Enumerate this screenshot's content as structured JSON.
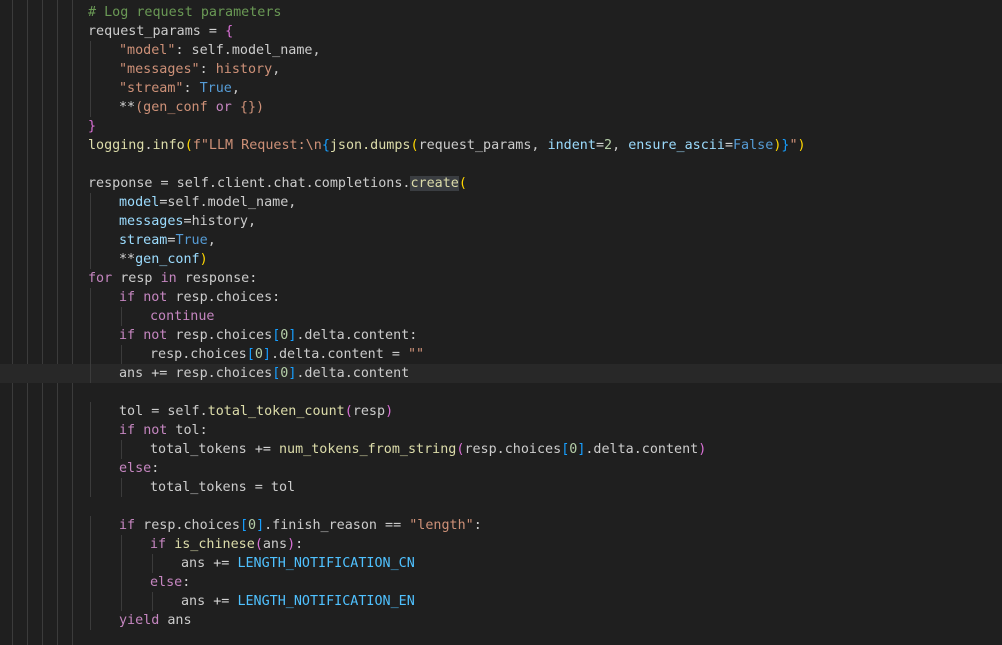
{
  "theme": {
    "background": "#1f1f1f",
    "current_line": "#282828",
    "guides": "#3b3b3b"
  },
  "code": {
    "current_line_index": 19,
    "lines": [
      {
        "indent": 0,
        "segments": [
          [
            "# Log request parameters",
            "comment"
          ]
        ]
      },
      {
        "indent": 0,
        "segments": [
          [
            "request_params",
            "default"
          ],
          [
            " = ",
            "operator"
          ],
          [
            "{",
            "bracket2"
          ]
        ]
      },
      {
        "indent": 1,
        "segments": [
          [
            "\"model\"",
            "string"
          ],
          [
            ": self.model_name,",
            "default"
          ]
        ]
      },
      {
        "indent": 1,
        "segments": [
          [
            "\"messages\"",
            "string"
          ],
          [
            ": ",
            "default"
          ],
          [
            "history",
            "string"
          ],
          [
            ",",
            "default"
          ]
        ]
      },
      {
        "indent": 1,
        "segments": [
          [
            "\"stream\"",
            "string"
          ],
          [
            ": ",
            "default"
          ],
          [
            "True",
            "keyword2"
          ],
          [
            ",",
            "default"
          ]
        ]
      },
      {
        "indent": 1,
        "segments": [
          [
            "**",
            "operator"
          ],
          [
            "(gen_conf ",
            "string"
          ],
          [
            "or",
            "keyword"
          ],
          [
            " {})",
            "string"
          ]
        ]
      },
      {
        "indent": 0,
        "segments": [
          [
            "}",
            "bracket2"
          ]
        ]
      },
      {
        "indent": 0,
        "segments": [
          [
            "logging",
            "func"
          ],
          [
            ".",
            "default"
          ],
          [
            "info",
            "func"
          ],
          [
            "(",
            "bracket1"
          ],
          [
            "f\"LLM Request:\\n",
            "string"
          ],
          [
            "{",
            "bracket3"
          ],
          [
            "json.dumps",
            "func"
          ],
          [
            "(",
            "bracket1"
          ],
          [
            "request_params, ",
            "default"
          ],
          [
            "indent",
            "param"
          ],
          [
            "=",
            "operator"
          ],
          [
            "2",
            "number"
          ],
          [
            ", ",
            "default"
          ],
          [
            "ensure_ascii",
            "param"
          ],
          [
            "=",
            "operator"
          ],
          [
            "False",
            "keyword2"
          ],
          [
            ")",
            "bracket1"
          ],
          [
            "}",
            "bracket3"
          ],
          [
            "\"",
            "string"
          ],
          [
            ")",
            "bracket1"
          ]
        ]
      },
      {
        "indent": 0,
        "segments": []
      },
      {
        "indent": 0,
        "segments": [
          [
            "response = self.client.chat.completions.",
            "default"
          ],
          [
            "create",
            "func",
            "hl"
          ],
          [
            "(",
            "bracket1"
          ]
        ]
      },
      {
        "indent": 1,
        "segments": [
          [
            "model",
            "param"
          ],
          [
            "=",
            "operator"
          ],
          [
            "self.model_name,",
            "default"
          ]
        ]
      },
      {
        "indent": 1,
        "segments": [
          [
            "messages",
            "param"
          ],
          [
            "=",
            "operator"
          ],
          [
            "history,",
            "default"
          ]
        ]
      },
      {
        "indent": 1,
        "segments": [
          [
            "stream",
            "param"
          ],
          [
            "=",
            "operator"
          ],
          [
            "True",
            "keyword2"
          ],
          [
            ",",
            "default"
          ]
        ]
      },
      {
        "indent": 1,
        "segments": [
          [
            "**",
            "operator"
          ],
          [
            "gen_conf",
            "param"
          ],
          [
            ")",
            "bracket1"
          ]
        ]
      },
      {
        "indent": 0,
        "segments": [
          [
            "for",
            "keyword"
          ],
          [
            " resp ",
            "default"
          ],
          [
            "in",
            "keyword"
          ],
          [
            " response:",
            "default"
          ]
        ]
      },
      {
        "indent": 1,
        "segments": [
          [
            "if",
            "keyword"
          ],
          [
            " ",
            "default"
          ],
          [
            "not",
            "keyword"
          ],
          [
            " resp.choices:",
            "default"
          ]
        ]
      },
      {
        "indent": 2,
        "segments": [
          [
            "continue",
            "keyword"
          ]
        ]
      },
      {
        "indent": 1,
        "segments": [
          [
            "if",
            "keyword"
          ],
          [
            " ",
            "default"
          ],
          [
            "not",
            "keyword"
          ],
          [
            " resp.choices",
            "default"
          ],
          [
            "[",
            "bracket3"
          ],
          [
            "0",
            "number"
          ],
          [
            "]",
            "bracket3"
          ],
          [
            ".delta.content:",
            "default"
          ]
        ]
      },
      {
        "indent": 2,
        "segments": [
          [
            "resp.choices",
            "default"
          ],
          [
            "[",
            "bracket3"
          ],
          [
            "0",
            "number"
          ],
          [
            "]",
            "bracket3"
          ],
          [
            ".delta.content = ",
            "default"
          ],
          [
            "\"\"",
            "string"
          ]
        ]
      },
      {
        "indent": 1,
        "segments": [
          [
            "ans ",
            "default"
          ],
          [
            "+=",
            "operator"
          ],
          [
            " resp.choices",
            "default"
          ],
          [
            "[",
            "bracket3"
          ],
          [
            "0",
            "number"
          ],
          [
            "]",
            "bracket3"
          ],
          [
            ".delta.content",
            "default"
          ]
        ]
      },
      {
        "indent": 0,
        "segments": []
      },
      {
        "indent": 1,
        "segments": [
          [
            "tol = self.",
            "default"
          ],
          [
            "total_token_count",
            "func"
          ],
          [
            "(",
            "bracket2"
          ],
          [
            "resp",
            "default"
          ],
          [
            ")",
            "bracket2"
          ]
        ]
      },
      {
        "indent": 1,
        "segments": [
          [
            "if",
            "keyword"
          ],
          [
            " ",
            "default"
          ],
          [
            "not",
            "keyword"
          ],
          [
            " tol:",
            "default"
          ]
        ]
      },
      {
        "indent": 2,
        "segments": [
          [
            "total_tokens ",
            "default"
          ],
          [
            "+=",
            "operator"
          ],
          [
            " ",
            "default"
          ],
          [
            "num_tokens_from_string",
            "func"
          ],
          [
            "(",
            "bracket2"
          ],
          [
            "resp.choices",
            "default"
          ],
          [
            "[",
            "bracket3"
          ],
          [
            "0",
            "number"
          ],
          [
            "]",
            "bracket3"
          ],
          [
            ".delta.content",
            "default"
          ],
          [
            ")",
            "bracket2"
          ]
        ]
      },
      {
        "indent": 1,
        "segments": [
          [
            "else",
            "keyword"
          ],
          [
            ":",
            "default"
          ]
        ]
      },
      {
        "indent": 2,
        "segments": [
          [
            "total_tokens = tol",
            "default"
          ]
        ]
      },
      {
        "indent": 0,
        "segments": []
      },
      {
        "indent": 1,
        "segments": [
          [
            "if",
            "keyword"
          ],
          [
            " resp.choices",
            "default"
          ],
          [
            "[",
            "bracket3"
          ],
          [
            "0",
            "number"
          ],
          [
            "]",
            "bracket3"
          ],
          [
            ".finish_reason == ",
            "default"
          ],
          [
            "\"length\"",
            "string"
          ],
          [
            ":",
            "default"
          ]
        ]
      },
      {
        "indent": 2,
        "segments": [
          [
            "if",
            "keyword"
          ],
          [
            " ",
            "default"
          ],
          [
            "is_chinese",
            "func"
          ],
          [
            "(",
            "bracket2"
          ],
          [
            "ans",
            "default"
          ],
          [
            ")",
            "bracket2"
          ],
          [
            ":",
            "default"
          ]
        ]
      },
      {
        "indent": 3,
        "segments": [
          [
            "ans ",
            "default"
          ],
          [
            "+=",
            "operator"
          ],
          [
            " ",
            "default"
          ],
          [
            "LENGTH_NOTIFICATION_CN",
            "const"
          ]
        ]
      },
      {
        "indent": 2,
        "segments": [
          [
            "else",
            "keyword"
          ],
          [
            ":",
            "default"
          ]
        ]
      },
      {
        "indent": 3,
        "segments": [
          [
            "ans ",
            "default"
          ],
          [
            "+=",
            "operator"
          ],
          [
            " ",
            "default"
          ],
          [
            "LENGTH_NOTIFICATION_EN",
            "const"
          ]
        ]
      },
      {
        "indent": 1,
        "segments": [
          [
            "yield",
            "keyword"
          ],
          [
            " ans",
            "default"
          ]
        ]
      }
    ]
  }
}
